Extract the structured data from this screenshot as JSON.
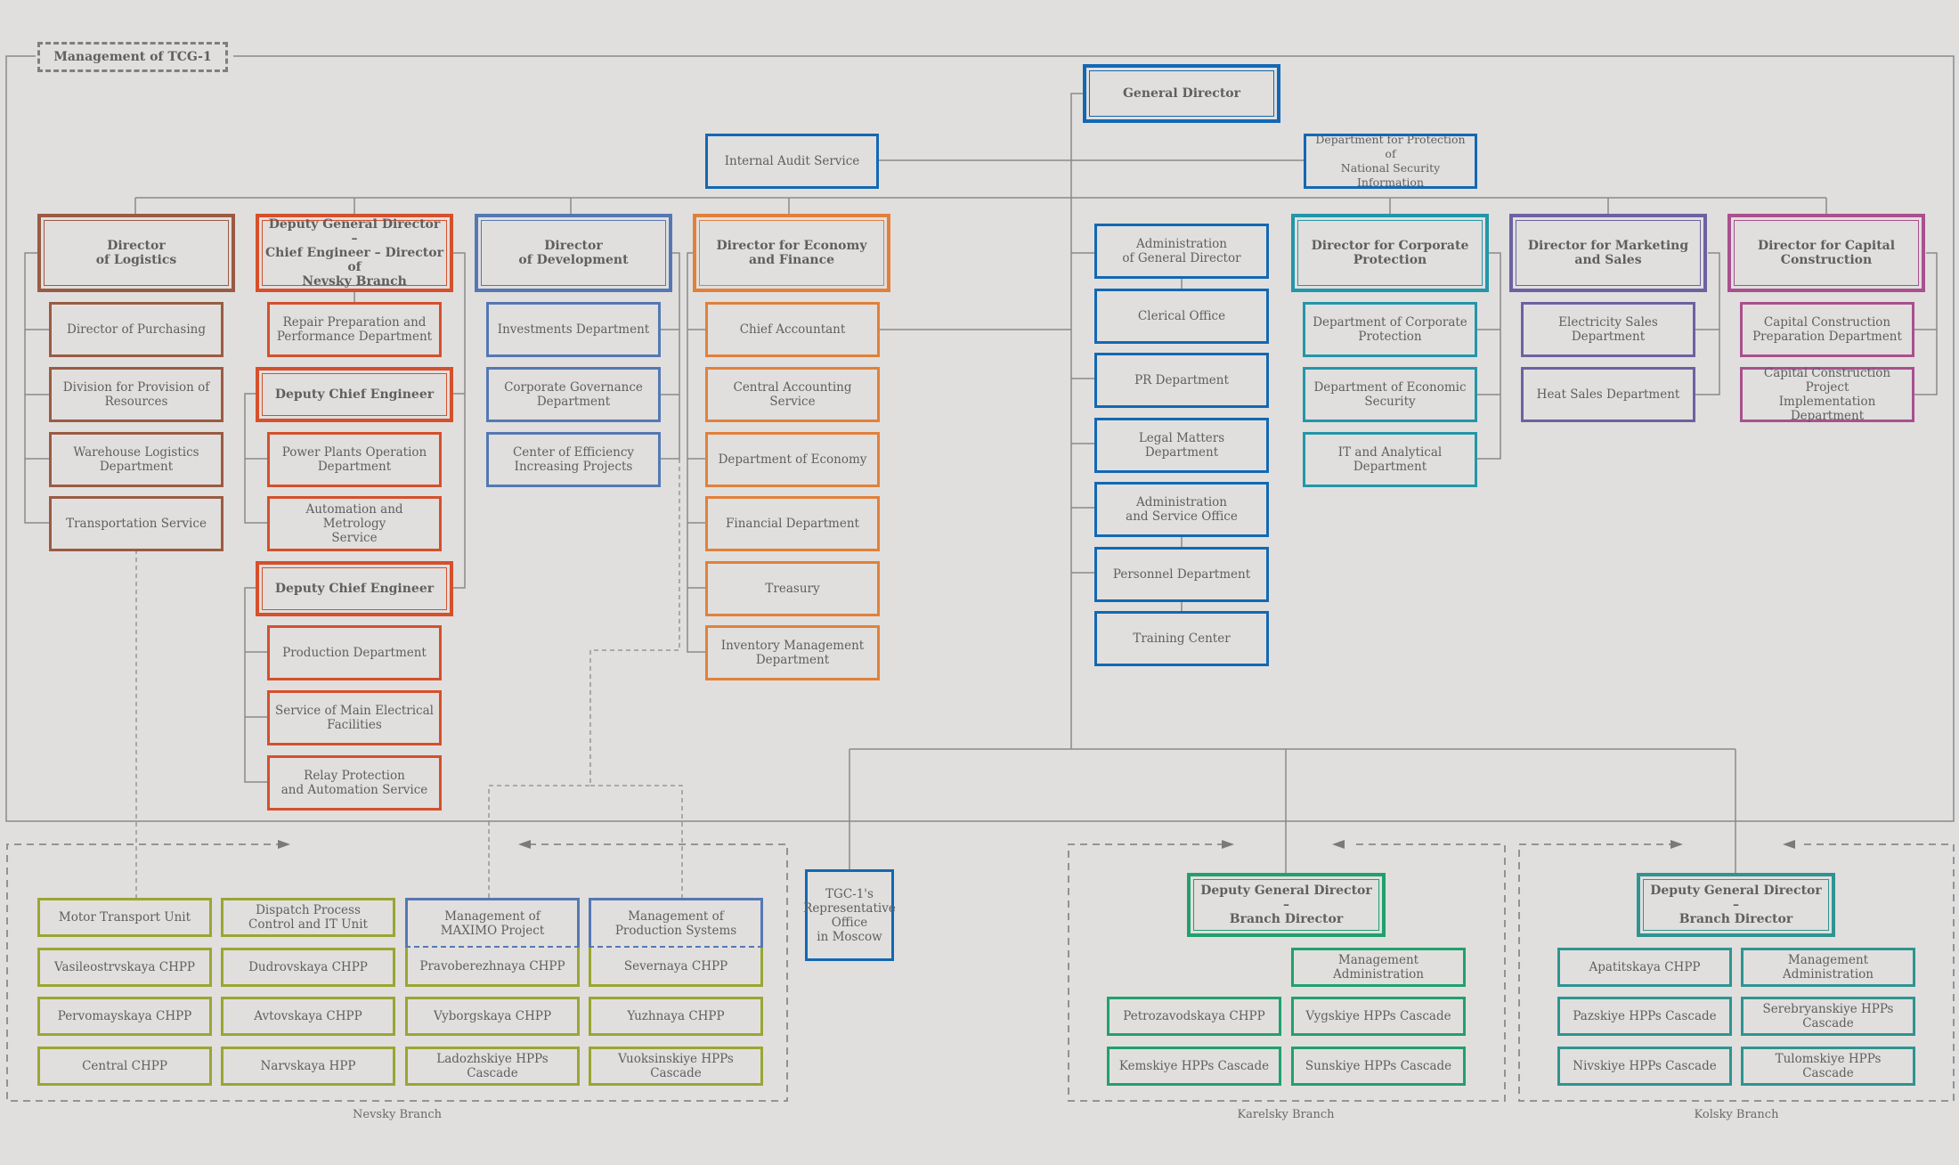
{
  "title": "Management of TCG-1",
  "colors": {
    "background": "#e0dfde",
    "general_management": "#1368b3",
    "logistics": "#9a5b43",
    "chief_engineer": "#d5502b",
    "development": "#5578b3",
    "economy_finance": "#e2803a",
    "corporate_protection": "#2396a8",
    "marketing_sales": "#6c62a0",
    "capital_construction": "#a9508e",
    "nevsky_branch": "#9aa632",
    "karelsky_branch": "#21a06e",
    "kolsky_branch": "#2f9490"
  },
  "top": {
    "general_director": "General Director",
    "internal_audit": "Internal Audit  Service",
    "national_security": "Department for Protection of\nNational Security Information"
  },
  "logistics": {
    "head": "Director\nof Logistics",
    "items": [
      "Director of Purchasing",
      "Division for Provision of\nResources",
      "Warehouse Logistics\nDepartment",
      "Transportation Service"
    ]
  },
  "chief_engineer": {
    "head": "Deputy General Director –\nChief Engineer – Director of\nNevsky Branch",
    "repair": "Repair Preparation and\nPerformance Department",
    "deputy1": {
      "head": "Deputy Chief Engineer",
      "items": [
        "Power Plants Operation\nDepartment",
        "Automation and Metrology\nService"
      ]
    },
    "deputy2": {
      "head": "Deputy Chief Engineer",
      "items": [
        "Production Department",
        "Service of Main Electrical\nFacilities",
        "Relay Protection\nand Automation Service"
      ]
    }
  },
  "development": {
    "head": "Director\nof Development",
    "items": [
      "Investments Department",
      "Corporate Governance\nDepartment",
      "Center of Efficiency\nIncreasing Projects"
    ]
  },
  "economy": {
    "head": "Director for Economy\nand Finance",
    "items": [
      "Chief Accountant",
      "Central Accounting Service",
      "Department of Economy",
      "Financial Department",
      "Treasury",
      "Inventory Management\nDepartment"
    ]
  },
  "gd_admin": {
    "items": [
      "Administration\nof General Director",
      "Clerical Office",
      "PR Department",
      "Legal Matters Department",
      "Administration\nand Service Office",
      "Personnel Department",
      "Training Center"
    ]
  },
  "corporate_protection": {
    "head": "Director for Corporate\nProtection",
    "items": [
      "Department of Corporate\nProtection",
      "Department of Economic\nSecurity",
      "IT and Analytical\nDepartment"
    ]
  },
  "marketing": {
    "head": "Director for Marketing\nand Sales",
    "items": [
      "Electricity Sales Department",
      "Heat Sales Department"
    ]
  },
  "capital": {
    "head": "Director for Capital\nConstruction",
    "items": [
      "Capital Construction\nPreparation Department",
      "Capital Construction Project\nImplementation Department"
    ]
  },
  "moscow_office": "TGC-1's\nRepresentative\nOffice\nin Moscow",
  "nevsky": {
    "label": "Nevsky Branch",
    "col1": [
      "Motor Transport Unit",
      "Vasileostrvskaya CHPP",
      "Pervomayskaya CHPP",
      "Central CHPP"
    ],
    "col2": [
      "Dispatch Process\nControl and IT Unit",
      "Dudrovskaya CHPP",
      "Avtovskaya CHPP",
      "Narvskaya HPP"
    ],
    "col3": [
      "Management of\nMAXIMO Project",
      "Pravoberezhnaya CHPP",
      "Vyborgskaya CHPP",
      "Ladozhskiye HPPs Cascade"
    ],
    "col4": [
      "Management of\nProduction Systems",
      "Severnaya CHPP",
      "Yuzhnaya CHPP",
      "Vuoksinskiye HPPs Cascade"
    ]
  },
  "karelsky": {
    "label": "Karelsky Branch",
    "head": "Deputy General Director –\nBranch Director",
    "mgmt": "Management Administration",
    "items": [
      "Petrozavodskaya CHPP",
      "Vygskiye HPPs Cascade",
      "Kemskiye HPPs Cascade",
      "Sunskiye HPPs Cascade"
    ]
  },
  "kolsky": {
    "label": "Kolsky Branch",
    "head": "Deputy General Director –\nBranch Director",
    "items": [
      "Apatitskaya CHPP",
      "Management Administration",
      "Pazskiye HPPs Cascade",
      "Serebryanskiye HPPs\nCascade",
      "Nivskiye HPPs  Cascade",
      "Tulomskiye HPPs Cascade"
    ]
  }
}
